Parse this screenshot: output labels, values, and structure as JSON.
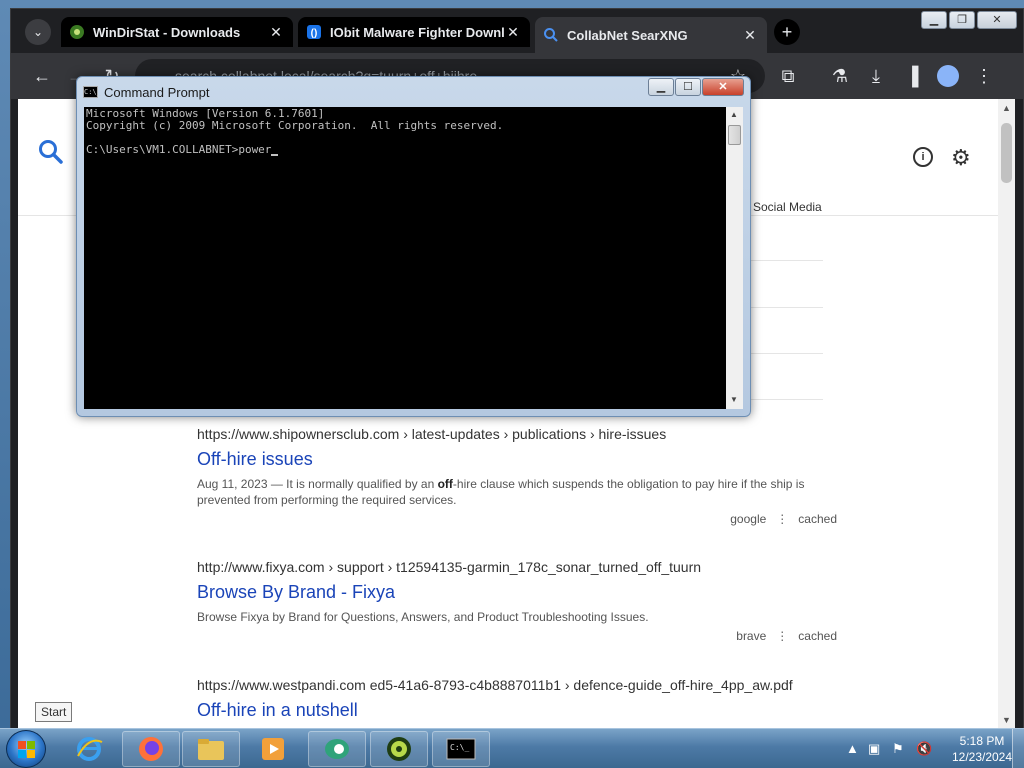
{
  "browser": {
    "tabs": [
      {
        "title": "WinDirStat - Downloads",
        "active": false
      },
      {
        "title": "IObit Malware Fighter Downlo",
        "active": false
      },
      {
        "title": "CollabNet SearXNG",
        "active": true
      }
    ],
    "url": "search.collabnet.local/search?q=tuurn+off+hiihre",
    "new_tab_label": "+",
    "close_glyph": "✕"
  },
  "searx": {
    "category_visible": "Social Media",
    "info_glyph": "i",
    "results": [
      {
        "url": "https://www.shipownersclub.com  › latest-updates › publications › hire-issues",
        "title": "Off-hire issues",
        "desc_before": "Aug 11, 2023 — It is normally qualified by an ",
        "desc_bold": "off",
        "desc_after": "-hire clause which suspends the obligation to pay hire if the ship is prevented from performing the required services.",
        "engine": "google",
        "cached": "cached"
      },
      {
        "url": "http://www.fixya.com  › support › t12594135-garmin_178c_sonar_turned_off_tuurn",
        "title": "Browse By Brand - Fixya",
        "desc_before": "Browse Fixya by Brand for Questions, Answers, and Product Troubleshooting Issues.",
        "desc_bold": "",
        "desc_after": "",
        "engine": "brave",
        "cached": "cached"
      },
      {
        "url": "https://www.westpandi.com  ed5-41a6-8793-c4b8887011b1 › defence-guide_off-hire_4pp_aw.pdf",
        "title": "Off-hire in a nutshell"
      }
    ]
  },
  "cmd": {
    "title": "Command Prompt",
    "icon_text": "C:\\_",
    "line1": "Microsoft Windows [Version 6.1.7601]",
    "line2": "Copyright (c) 2009 Microsoft Corporation.  All rights reserved.",
    "prompt": "C:\\Users\\VM1.COLLABNET>power"
  },
  "tooltip": "Start",
  "taskbar": {
    "apps": [
      "windows-explorer-ie",
      "firefox",
      "file-explorer",
      "media-player",
      "app-green",
      "windirstat",
      "command-prompt"
    ],
    "clock_time": "5:18 PM",
    "clock_date": "12/23/2024"
  },
  "colors": {
    "link_blue": "#1a44b8",
    "chrome_dark": "#35363a",
    "console_bg": "#000000"
  }
}
